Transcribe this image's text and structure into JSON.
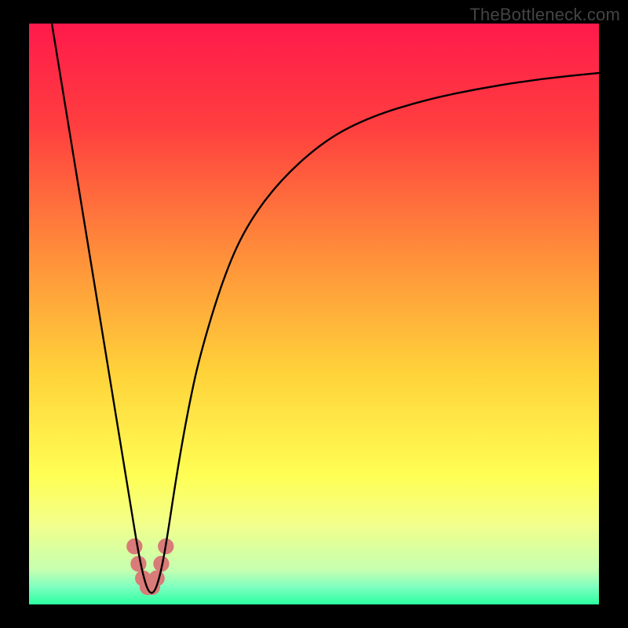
{
  "watermark": "TheBottleneck.com",
  "chart_data": {
    "type": "line",
    "title": "",
    "xlabel": "",
    "ylabel": "",
    "xlim": [
      0,
      100
    ],
    "ylim": [
      0,
      100
    ],
    "grid": false,
    "legend": false,
    "gradient_stops": [
      {
        "offset": 0.0,
        "color": "#ff1a4b"
      },
      {
        "offset": 0.18,
        "color": "#ff3f3f"
      },
      {
        "offset": 0.4,
        "color": "#ff8f3a"
      },
      {
        "offset": 0.6,
        "color": "#ffd23a"
      },
      {
        "offset": 0.78,
        "color": "#ffff55"
      },
      {
        "offset": 0.86,
        "color": "#f3ff8a"
      },
      {
        "offset": 0.94,
        "color": "#c6ffb0"
      },
      {
        "offset": 0.97,
        "color": "#7dffc0"
      },
      {
        "offset": 1.0,
        "color": "#2bff9e"
      }
    ],
    "series": [
      {
        "name": "bottleneck-curve",
        "color": "#000000",
        "x": [
          4,
          6,
          8,
          10,
          12,
          14,
          16,
          18,
          19,
          20,
          21,
          22,
          23,
          24,
          26,
          28,
          30,
          34,
          38,
          44,
          52,
          60,
          70,
          80,
          90,
          100
        ],
        "y": [
          100,
          88,
          76,
          64,
          52,
          40,
          28,
          16,
          10,
          5,
          2,
          2,
          5,
          10,
          23,
          34,
          43,
          56,
          65,
          73,
          80,
          84,
          87,
          89,
          90.5,
          91.5
        ]
      }
    ],
    "marker_cluster": {
      "name": "optimal-zone-dots",
      "color": "#d97b78",
      "radius_pct": 1.4,
      "points": [
        {
          "x": 18.5,
          "y": 10
        },
        {
          "x": 19.2,
          "y": 7
        },
        {
          "x": 20.0,
          "y": 4.5
        },
        {
          "x": 20.8,
          "y": 3
        },
        {
          "x": 21.6,
          "y": 3
        },
        {
          "x": 22.4,
          "y": 4.5
        },
        {
          "x": 23.2,
          "y": 7
        },
        {
          "x": 24.0,
          "y": 10
        }
      ]
    }
  }
}
